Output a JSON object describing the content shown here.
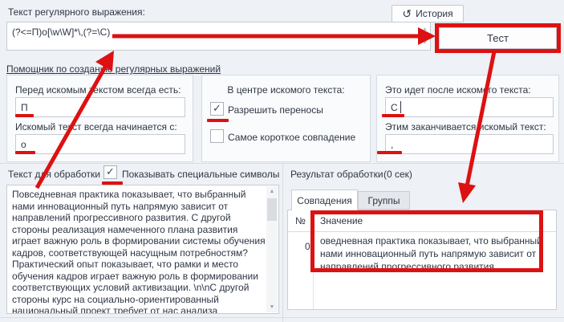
{
  "colors": {
    "annotation": "#dd1111"
  },
  "icons": {
    "history": "↺",
    "check": "✓",
    "spin_up": "▲",
    "spin_down": "▼",
    "scroll_up": "▲",
    "scroll_down": "▼"
  },
  "regex_section": {
    "label": "Текст регулярного выражения:",
    "history_button": "История",
    "value": "(?<=П)о[\\w\\W]*\\,(?=\\С)",
    "test_button": "Тест"
  },
  "helper": {
    "link": "Помощник по созданию регулярных выражений",
    "before": {
      "label": "Перед искомым текстом всегда есть:",
      "value": "П"
    },
    "starts": {
      "label": "Искомый текст всегда начинается с:",
      "value": "о"
    },
    "center": {
      "label": "В центре искомого текста:",
      "wrap": "Разрешить переносы",
      "shortest": "Самое короткое совпадение"
    },
    "after": {
      "label": "Это идет после искомого текста:",
      "value": "С"
    },
    "ends": {
      "label": "Этим заканчивается искомый текст:",
      "value": ","
    }
  },
  "process": {
    "label": "Текст для обработки",
    "show_special": "Показывать специальные символы",
    "lines": [
      "Повседневная практика показывает, что выбранный",
      "нами инновационный путь напрямую зависит от",
      "направлений прогрессивного развития. С другой",
      "стороны реализация намеченного плана развития",
      "играет важную роль в формировании системы обучения",
      "кадров, соответствующей насущным потребностям?",
      "Практический опыт показывает, что рамки и место",
      "обучения кадров играет важную роль в формировании",
      "соответствующих условий активизации. \\n\\nС другой",
      "стороны курс на социально-ориентированный",
      "национальный проект требует от нас анализа"
    ]
  },
  "result": {
    "label": "Результат обработки",
    "time": "(0 сек)",
    "tabs": [
      "Совпадения",
      "Группы"
    ],
    "columns": {
      "num": "№",
      "value": "Значение"
    },
    "row": {
      "num": "0",
      "lines": [
        "оведневная практика показывает, что выбранный",
        "нами инновационный путь напрямую зависит от",
        "направлений прогрессивного развития."
      ]
    }
  }
}
